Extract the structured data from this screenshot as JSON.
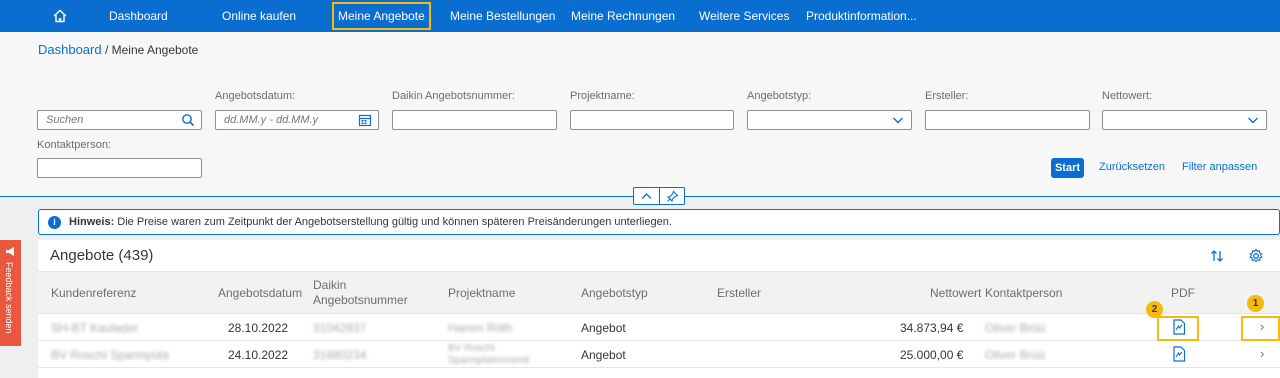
{
  "nav": {
    "items": [
      "Dashboard",
      "Online kaufen",
      "Meine Angebote",
      "Meine Bestellungen",
      "Meine Rechnungen",
      "Weitere Services",
      "Produktinformation..."
    ],
    "active_index": 2
  },
  "breadcrumb": {
    "root": "Dashboard",
    "current": " / Meine Angebote"
  },
  "filters": {
    "search_placeholder": "Suchen",
    "angebotsdatum_label": "Angebotsdatum:",
    "angebotsdatum_placeholder": "dd.MM.y - dd.MM.y",
    "nummer_label": "Daikin Angebotsnummer:",
    "projekt_label": "Projektname:",
    "typ_label": "Angebotstyp:",
    "ersteller_label": "Ersteller:",
    "nettowert_label": "Nettowert:",
    "kontakt_label": "Kontaktperson:",
    "start": "Start",
    "reset": "Zurücksetzen",
    "adapt": "Filter anpassen"
  },
  "info": {
    "bold": "Hinweis:",
    "text": " Die Preise waren zum Zeitpunkt der Angebotserstellung gültig und können späteren Preisänderungen unterliegen."
  },
  "feedback": "Feedback senden",
  "table": {
    "title": "Angebote (439)",
    "columns": {
      "kundenreferenz": "Kundenreferenz",
      "angebotsdatum": "Angebotsdatum",
      "nummer_1": "Daikin",
      "nummer_2": "Angebotsnummer",
      "projektname": "Projektname",
      "angebotstyp": "Angebotstyp",
      "ersteller": "Ersteller",
      "nettowert": "Nettowert",
      "kontakt": "Kontaktperson",
      "pdf": "PDF"
    },
    "rows": [
      {
        "kundenreferenz": "SH-BT Kaulader",
        "datum": "28.10.2022",
        "nummer": "31042837",
        "projekt": "Hamm Röth",
        "typ": "Angebot",
        "nettowert": "34.873,94 €",
        "kontakt": "Oliver Brüü"
      },
      {
        "kundenreferenz": "BV Roschi Sparmpüta",
        "datum": "24.10.2022",
        "nummer": "31680234",
        "projekt_1": "BV Roschi",
        "projekt_2": "Sparmplatenmenti",
        "typ": "Angebot",
        "nettowert": "25.000,00 €",
        "kontakt": "Oliver Brüü"
      }
    ]
  },
  "callouts": {
    "one": "1",
    "two": "2"
  },
  "colors": {
    "brand": "#0a6ed1",
    "highlight": "#f5b90f",
    "feedback": "#e9573f"
  }
}
